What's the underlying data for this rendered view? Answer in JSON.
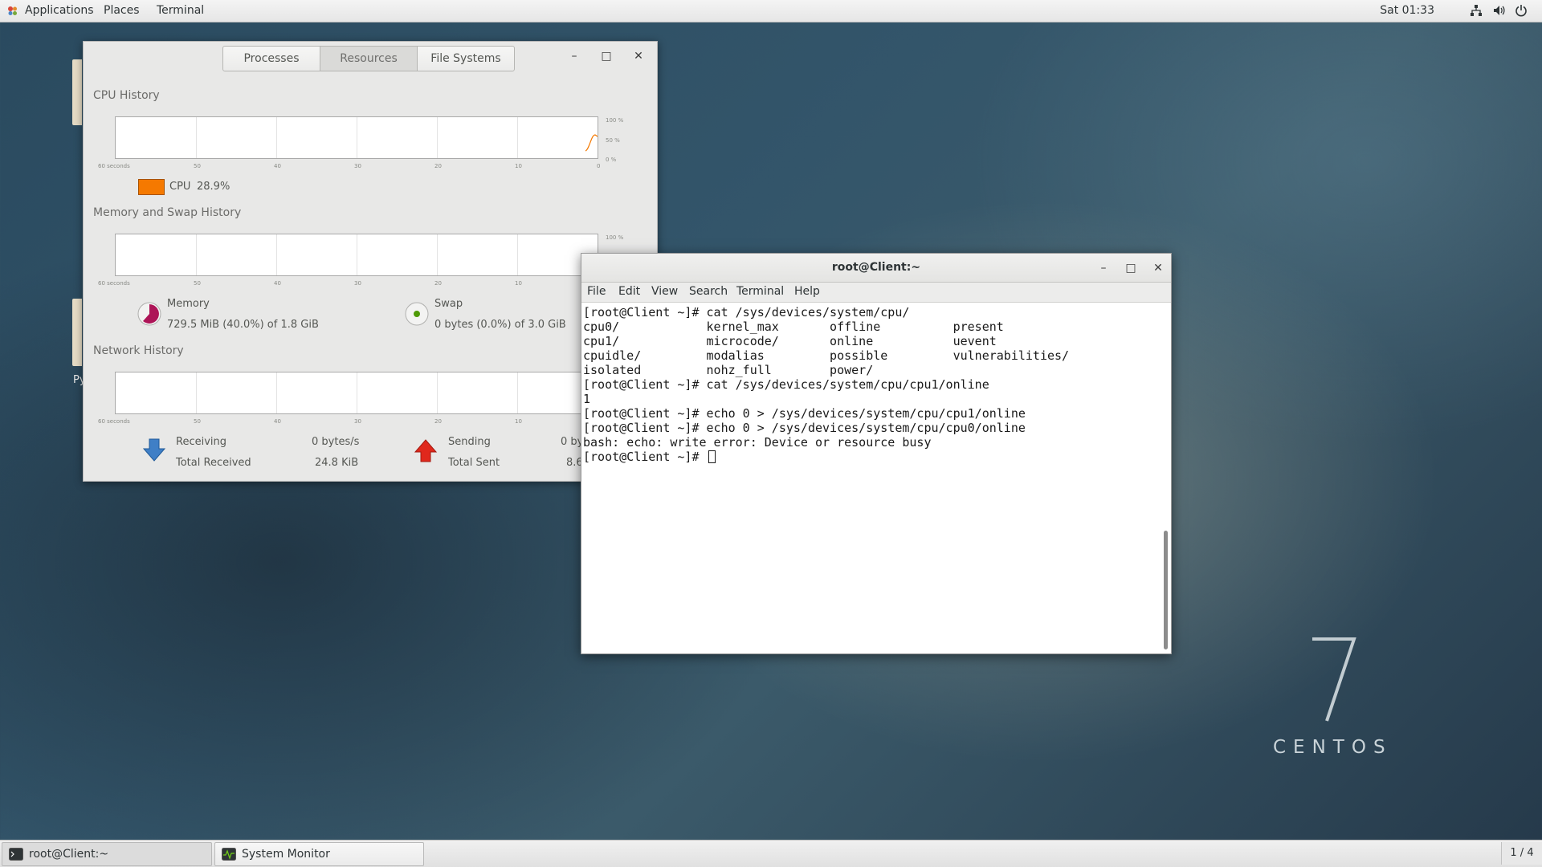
{
  "topbar": {
    "applications": "Applications",
    "places": "Places",
    "terminal": "Terminal",
    "clock": "Sat 01:33",
    "tray_icons": [
      "network-icon",
      "volume-icon",
      "power-icon"
    ]
  },
  "desktop": {
    "fragment_label": "Py"
  },
  "sysmon": {
    "tabs": [
      "Processes",
      "Resources",
      "File Systems"
    ],
    "active_tab": "Resources",
    "cpu": {
      "title": "CPU History",
      "label": "CPU",
      "value": "28.9%",
      "color": "#f57900"
    },
    "memory": {
      "title": "Memory and Swap History",
      "mem_label": "Memory",
      "mem_value": "729.5 MiB (40.0%) of 1.8 GiB",
      "mem_color": "#ad1457",
      "swap_label": "Swap",
      "swap_value": "0 bytes (0.0%) of 3.0 GiB",
      "swap_color": "#4e9a06"
    },
    "network": {
      "title": "Network History",
      "receiving_label": "Receiving",
      "receiving_value": "0 bytes/s",
      "total_received_label": "Total Received",
      "total_received_value": "24.8 KiB",
      "sending_label": "Sending",
      "sending_value": "0 by",
      "total_sent_label": "Total Sent",
      "total_sent_value": "8.6"
    },
    "x_ticks": [
      "60 seconds",
      "50",
      "40",
      "30",
      "20",
      "10",
      "0"
    ],
    "y_ticks": [
      "100 %",
      "50 %",
      "0 %"
    ]
  },
  "terminal": {
    "title": "root@Client:~",
    "menu": [
      "File",
      "Edit",
      "View",
      "Search",
      "Terminal",
      "Help"
    ],
    "lines": [
      "[root@Client ~]# cat /sys/devices/system/cpu/",
      "cpu0/            kernel_max       offline          present",
      "cpu1/            microcode/       online           uevent",
      "cpuidle/         modalias         possible         vulnerabilities/",
      "isolated         nohz_full        power/",
      "[root@Client ~]# cat /sys/devices/system/cpu/cpu1/online",
      "1",
      "[root@Client ~]# echo 0 > /sys/devices/system/cpu/cpu1/online",
      "[root@Client ~]# echo 0 > /sys/devices/system/cpu/cpu0/online",
      "bash: echo: write error: Device or resource busy"
    ],
    "prompt": "[root@Client ~]# "
  },
  "branding": {
    "word": "CENTOS"
  },
  "taskbar": {
    "items": [
      "root@Client:~",
      "System Monitor"
    ],
    "pager": "1 / 4"
  }
}
